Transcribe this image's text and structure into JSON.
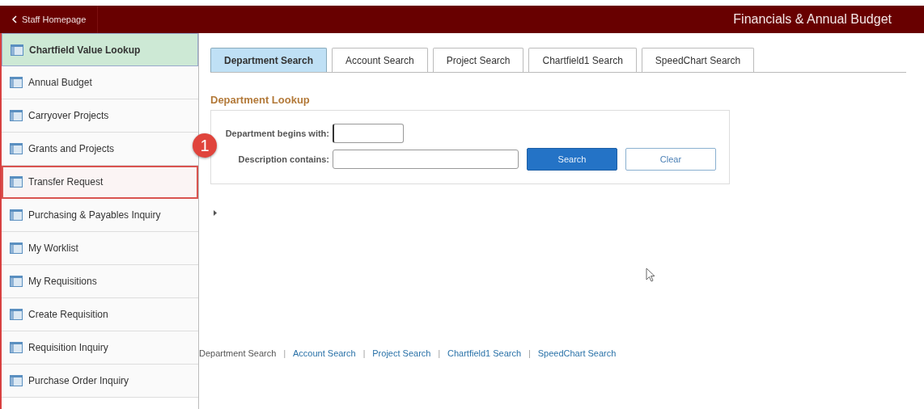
{
  "header": {
    "back_label": "Staff Homepage",
    "title": "Financials & Annual Budget"
  },
  "sidebar": {
    "items": [
      {
        "label": "Chartfield Value Lookup",
        "selected": true,
        "highlighted": false
      },
      {
        "label": "Annual Budget",
        "selected": false,
        "highlighted": false
      },
      {
        "label": "Carryover Projects",
        "selected": false,
        "highlighted": false
      },
      {
        "label": "Grants and Projects",
        "selected": false,
        "highlighted": false
      },
      {
        "label": "Transfer Request",
        "selected": false,
        "highlighted": true
      },
      {
        "label": "Purchasing & Payables Inquiry",
        "selected": false,
        "highlighted": false
      },
      {
        "label": "My Worklist",
        "selected": false,
        "highlighted": false
      },
      {
        "label": "My Requisitions",
        "selected": false,
        "highlighted": false
      },
      {
        "label": "Create Requisition",
        "selected": false,
        "highlighted": false
      },
      {
        "label": "Requisition Inquiry",
        "selected": false,
        "highlighted": false
      },
      {
        "label": "Purchase Order Inquiry",
        "selected": false,
        "highlighted": false
      }
    ]
  },
  "callout": {
    "label": "1"
  },
  "tabs": [
    {
      "label": "Department Search",
      "selected": true
    },
    {
      "label": "Account Search",
      "selected": false
    },
    {
      "label": "Project Search",
      "selected": false
    },
    {
      "label": "Chartfield1 Search",
      "selected": false
    },
    {
      "label": "SpeedChart Search",
      "selected": false
    }
  ],
  "lookup": {
    "title": "Department Lookup",
    "fields": [
      {
        "label": "Department begins with:",
        "kind": "short"
      },
      {
        "label": "Description contains:",
        "kind": "long"
      }
    ],
    "buttons": [
      {
        "label": "Search",
        "kind": "primary"
      },
      {
        "label": "Clear",
        "kind": "secondary"
      }
    ]
  },
  "footer_separator": "|",
  "footer_links": [
    {
      "label": "Department Search",
      "selected": true
    },
    {
      "label": "Account Search",
      "selected": false
    },
    {
      "label": "Project Search",
      "selected": false
    },
    {
      "label": "Chartfield1 Search",
      "selected": false
    },
    {
      "label": "SpeedChart Search",
      "selected": false
    }
  ]
}
